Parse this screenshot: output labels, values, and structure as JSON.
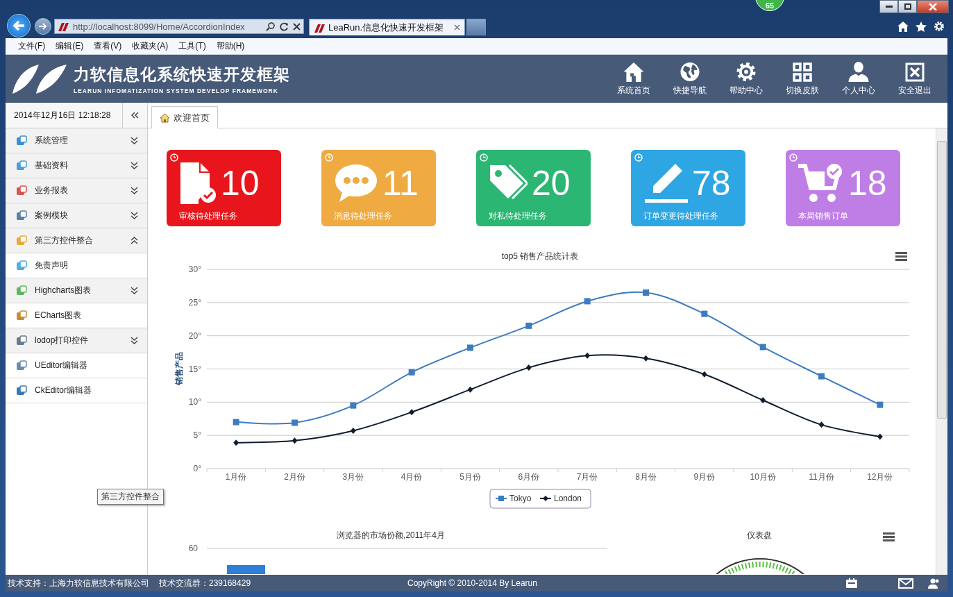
{
  "browser": {
    "address": "http://localhost:8099/Home/AccordionIndex",
    "tab_title": "LeaRun.信息化快速开发框架",
    "badge": "65"
  },
  "menu_bar": [
    "文件(F)",
    "编辑(E)",
    "查看(V)",
    "收藏夹(A)",
    "工具(T)",
    "帮助(H)"
  ],
  "header": {
    "title": "力软信息化系统快速开发框架",
    "subtitle": "LEARUN INFOMATIZATION SYSTEM DEVELOP FRAMEWORK",
    "nav": [
      {
        "label": "系统首页"
      },
      {
        "label": "快捷导航"
      },
      {
        "label": "帮助中心"
      },
      {
        "label": "切换皮肤"
      },
      {
        "label": "个人中心"
      },
      {
        "label": "安全退出"
      }
    ]
  },
  "sidebar": {
    "datetime": "2014年12月16日 12:18:28",
    "items": [
      {
        "kind": "group",
        "label": "系统管理",
        "expanded": false
      },
      {
        "kind": "group",
        "label": "基础资料",
        "expanded": false
      },
      {
        "kind": "group",
        "label": "业务报表",
        "expanded": false
      },
      {
        "kind": "group",
        "label": "案例模块",
        "expanded": false
      },
      {
        "kind": "group",
        "label": "第三方控件整合",
        "expanded": true
      },
      {
        "kind": "link",
        "label": "免责声明"
      },
      {
        "kind": "group",
        "label": "Highcharts图表",
        "expanded": false
      },
      {
        "kind": "link",
        "label": "ECharts图表"
      },
      {
        "kind": "group",
        "label": "lodop打印控件",
        "expanded": false
      },
      {
        "kind": "link",
        "label": "UEditor编辑器"
      },
      {
        "kind": "link",
        "label": "CkEditor编辑器"
      }
    ]
  },
  "tooltip": "第三方控件整合",
  "tabs": [
    {
      "label": "欢迎首页",
      "selected": true
    }
  ],
  "cards": [
    {
      "value": "10",
      "label": "审核待处理任务",
      "color": "#e8161c"
    },
    {
      "value": "11",
      "label": "消息待处理任务",
      "color": "#efab41"
    },
    {
      "value": "20",
      "label": "对私待处理任务",
      "color": "#2bb673"
    },
    {
      "value": "78",
      "label": "订单变更待处理任务",
      "color": "#2fa6e4"
    },
    {
      "value": "18",
      "label": "本周销售订单",
      "color": "#bf7ee6"
    }
  ],
  "sales_chart": {
    "chart_data": {
      "type": "line",
      "title": "top5 销售产品统计表",
      "ylabel": "销售产品",
      "categories": [
        "1月份",
        "2月份",
        "3月份",
        "4月份",
        "5月份",
        "6月份",
        "7月份",
        "8月份",
        "9月份",
        "10月份",
        "11月份",
        "12月份"
      ],
      "series": [
        {
          "name": "Tokyo",
          "color": "#3d7cc0",
          "marker": "square",
          "values": [
            7.0,
            6.9,
            9.5,
            14.5,
            18.2,
            21.5,
            25.2,
            26.5,
            23.3,
            18.3,
            13.9,
            9.6
          ]
        },
        {
          "name": "London",
          "color": "#0f1d2e",
          "marker": "diamond",
          "values": [
            3.9,
            4.2,
            5.7,
            8.5,
            11.9,
            15.2,
            17.0,
            16.6,
            14.2,
            10.3,
            6.6,
            4.8
          ]
        }
      ],
      "ylim": [
        0,
        30
      ],
      "grid": true,
      "legend": true,
      "yticks": [
        {
          "value": 0,
          "label": "0°"
        },
        {
          "value": 5,
          "label": "5°"
        },
        {
          "value": 10,
          "label": "10°"
        },
        {
          "value": 15,
          "label": "15°"
        },
        {
          "value": 20,
          "label": "20°"
        },
        {
          "value": 25,
          "label": "25°"
        },
        {
          "value": 30,
          "label": "30°"
        }
      ]
    }
  },
  "browser_share_chart": {
    "title": "浏览器的市场份额,2011年4月",
    "tick": "60"
  },
  "gauge_chart": {
    "title": "仪表盘"
  },
  "footer": {
    "support": "技术支持：上海力软信息技术有限公司",
    "group": "技术交流群：239168429",
    "copyright": "CopyRight © 2010-2014 By Learun"
  }
}
